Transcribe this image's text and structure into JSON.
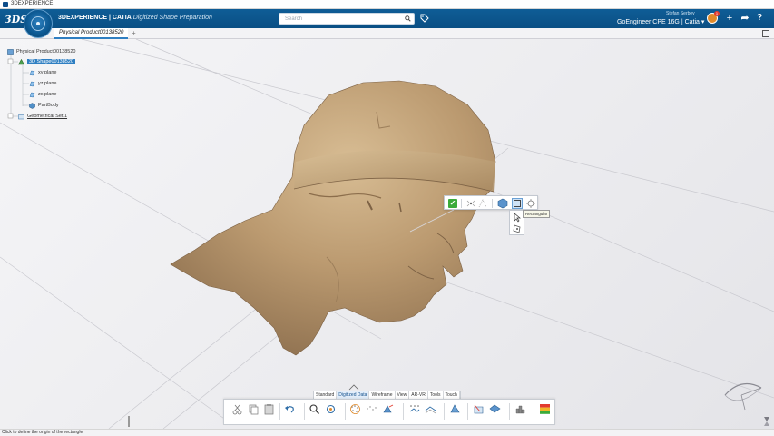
{
  "os": {
    "title": "3DEXPERIENCE"
  },
  "header": {
    "brand_prefix": "3D",
    "brand_main": "EXPERIENCE | CATIA",
    "brand_app": "Digitized Shape Preparation",
    "search_placeholder": "Search",
    "user_name": "Stefan Serbey",
    "user_org": "GoEngineer CPE 16G | Catia ▾",
    "notification_count": "1"
  },
  "tabs": {
    "doc_tab": "Physical Product00138520",
    "add": "+"
  },
  "tree": [
    {
      "label": "Physical Product00138520",
      "icon": "product-icon",
      "selected": false,
      "underline": false
    },
    {
      "label": "3D Shape00138520",
      "icon": "shape-icon",
      "selected": true,
      "underline": false
    },
    {
      "label": "xy plane",
      "icon": "plane-icon",
      "selected": false,
      "underline": false
    },
    {
      "label": "yz plane",
      "icon": "plane-icon",
      "selected": false,
      "underline": false
    },
    {
      "label": "zx plane",
      "icon": "plane-icon",
      "selected": false,
      "underline": false
    },
    {
      "label": "PartBody",
      "icon": "partbody-icon",
      "selected": false,
      "underline": false
    },
    {
      "label": "Geometrical Set.1",
      "icon": "geometrical-set-icon",
      "selected": false,
      "underline": true
    }
  ],
  "context": {
    "tooltip": "Rectangular"
  },
  "action_tabs": [
    "Standard",
    "Digitized Data",
    "Wireframe",
    "View",
    "AR-VR",
    "Tools",
    "Touch"
  ],
  "active_action_tab": 1,
  "status": {
    "text": "Click to define the origin of the rectangle"
  },
  "colors": {
    "header": "#0a4f84",
    "accent": "#2f7fc2",
    "mesh": "#b89870",
    "confirm": "#3bab3b"
  }
}
